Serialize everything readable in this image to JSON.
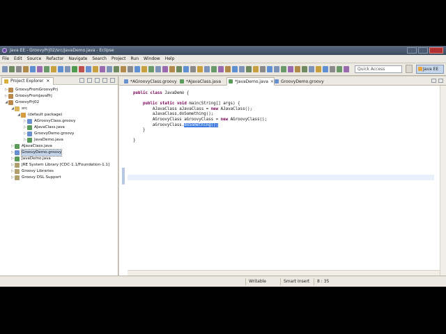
{
  "window": {
    "title": "Java EE - GroovyPrj02/src/JavaDemo.java - Eclipse"
  },
  "menu": [
    "File",
    "Edit",
    "Source",
    "Refactor",
    "Navigate",
    "Search",
    "Project",
    "Run",
    "Window",
    "Help"
  ],
  "toolbar": {
    "quick_access_placeholder": "Quick Access",
    "perspective": "Java EE"
  },
  "explorer": {
    "title": "Project Explorer",
    "close": "✕",
    "items": [
      {
        "label": "GroovyFromGroovyPrj",
        "depth": 0,
        "icon": "project-icon",
        "expanded": false
      },
      {
        "label": "GroovyFromJavaPrj",
        "depth": 0,
        "icon": "project-icon",
        "expanded": false
      },
      {
        "label": "GroovyPrj02",
        "depth": 0,
        "icon": "project-icon",
        "expanded": true
      },
      {
        "label": "src",
        "depth": 1,
        "icon": "source-folder-icon",
        "expanded": true
      },
      {
        "label": "(default package)",
        "depth": 2,
        "icon": "package-icon",
        "expanded": true
      },
      {
        "label": "AGroovyClass.groovy",
        "depth": 3,
        "icon": "groovy-file-icon",
        "expanded": false
      },
      {
        "label": "AJavaClass.java",
        "depth": 3,
        "icon": "java-file-icon",
        "expanded": false
      },
      {
        "label": "GroovyDemo.groovy",
        "depth": 3,
        "icon": "groovy-file-icon",
        "expanded": false
      },
      {
        "label": "JavaDemo.java",
        "depth": 3,
        "icon": "java-file-icon",
        "expanded": false
      },
      {
        "label": "AJavaClass.java",
        "depth": 1,
        "icon": "java-file-icon",
        "expanded": false
      },
      {
        "label": "GroovyDemo.groovy",
        "depth": 1,
        "icon": "groovy-file-icon",
        "expanded": false,
        "selected": true
      },
      {
        "label": "JavaDemo.java",
        "depth": 1,
        "icon": "java-file-icon",
        "expanded": false
      },
      {
        "label": "JRE System Library [CDC-1.1/Foundation-1.1]",
        "depth": 1,
        "icon": "library-icon",
        "expanded": false
      },
      {
        "label": "Groovy Libraries",
        "depth": 1,
        "icon": "library-icon",
        "expanded": false
      },
      {
        "label": "Groovy DSL Support",
        "depth": 1,
        "icon": "library-icon",
        "expanded": false
      }
    ]
  },
  "editor": {
    "tabs": [
      {
        "label": "*AGroovyClass.groovy",
        "kind": "groovy",
        "active": false
      },
      {
        "label": "*AJavaClass.java",
        "kind": "java",
        "active": false
      },
      {
        "label": "*JavaDemo.java",
        "kind": "java",
        "active": true
      },
      {
        "label": "GroovyDemo.groovy",
        "kind": "groovy",
        "active": false
      }
    ],
    "code": [
      "public class JavaDemo {",
      "",
      "    public static void main(String[] args) {",
      "        AJavaClass aJavaClass = new AJavaClass();",
      "        aJavaClass.doSomething();",
      "        AGroovyClass aGroovyClass = new AGroovyClass();",
      "        aGroovyClass.",
      "    }",
      "",
      "}"
    ],
    "selection_text": "doSomething();"
  },
  "status": {
    "writable": "Writable",
    "insert_mode": "Smart Insert",
    "position": "8 : 35"
  }
}
